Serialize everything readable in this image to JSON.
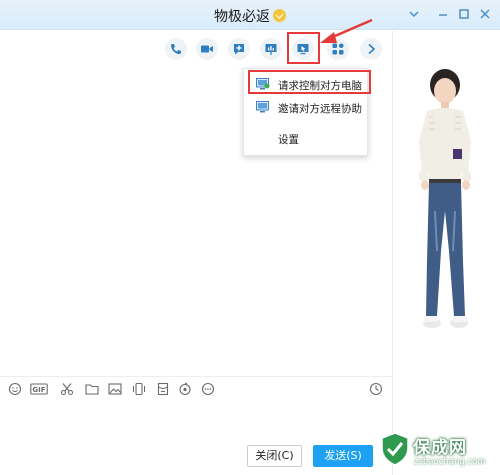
{
  "window": {
    "title": "物极必返",
    "controls": [
      "chevron-down-icon",
      "minimize-icon",
      "maximize-icon",
      "close-icon"
    ]
  },
  "toolbar": {
    "buttons": [
      {
        "name": "voice-call",
        "icon": "phone-icon"
      },
      {
        "name": "video-call",
        "icon": "video-icon"
      },
      {
        "name": "add-chat",
        "icon": "add-chat-icon"
      },
      {
        "name": "share-screen",
        "icon": "presentation-icon"
      },
      {
        "name": "remote-assist",
        "icon": "remote-desktop-icon",
        "highlighted": true
      },
      {
        "name": "apps",
        "icon": "apps-icon"
      },
      {
        "name": "more",
        "icon": "chevron-right-icon"
      }
    ]
  },
  "remote_menu": {
    "items": [
      {
        "label": "请求控制对方电脑",
        "icon": "monitor-control-icon",
        "highlighted": true
      },
      {
        "label": "邀请对方远程协助",
        "icon": "monitor-invite-icon"
      },
      {
        "label": "设置",
        "icon": ""
      }
    ]
  },
  "input_toolbar": {
    "tools": [
      "emoji-icon",
      "gif-icon",
      "scissors-icon",
      "folder-icon",
      "image-icon",
      "shake-icon",
      "red-packet-icon",
      "music-icon",
      "more-icon",
      "history-clock-icon"
    ]
  },
  "actions": {
    "close_label": "关闭(C)",
    "send_label": "发送(S)"
  },
  "watermark": {
    "text": "保成网",
    "url": "zsbaochang.com"
  },
  "colors": {
    "accent": "#1da1f2",
    "toolbar_icon": "#2f7fc0",
    "highlight_red": "#e43a3a"
  }
}
